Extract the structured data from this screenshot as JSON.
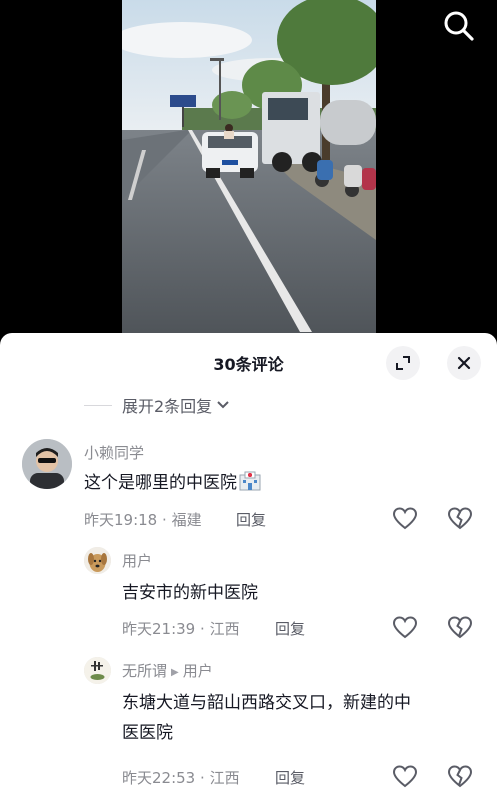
{
  "header": {
    "search_icon": "search-icon"
  },
  "sheet": {
    "title": "30条评论",
    "expand_label": "展开2条回复",
    "expand_icon": "chevron-down-icon",
    "fullscreen_icon": "expand-icon",
    "close_icon": "close-icon"
  },
  "comments": [
    {
      "username": "小赖同学",
      "text": "这个是哪里的中医院",
      "emoji": "hospital-emoji",
      "time": "昨天19:18",
      "sep": "·",
      "location": "福建",
      "reply": "回复"
    },
    {
      "username": "用户",
      "text": "吉安市的新中医院",
      "time": "昨天21:39",
      "sep": "·",
      "location": "江西",
      "reply": "回复"
    },
    {
      "username": "无所谓",
      "reply_to": "用户",
      "text_line1": "东塘大道与韶山西路交叉口，新建的中",
      "text_line2": "医医院",
      "time": "昨天22:53",
      "sep": "·",
      "location": "江西",
      "reply": "回复"
    }
  ],
  "colors": {
    "text": "#161823",
    "muted": "#8a8b91",
    "sheet_bg": "#ffffff"
  }
}
